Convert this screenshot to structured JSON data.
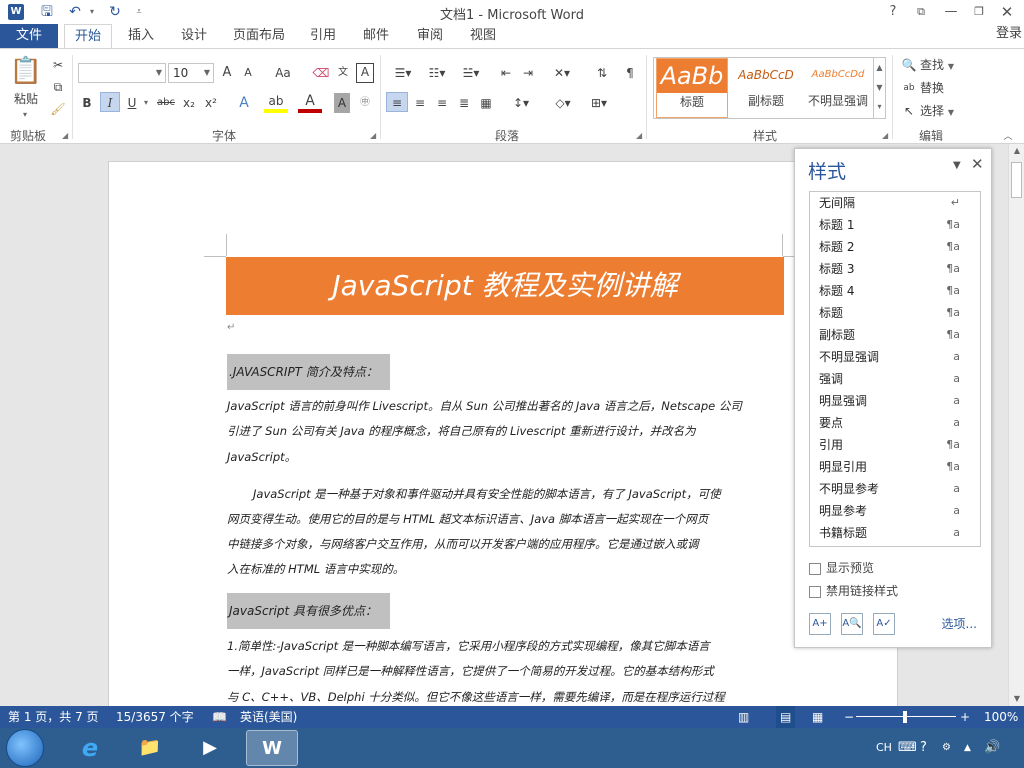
{
  "titlebar": {
    "app_icon": "W",
    "title": "文档1 - Microsoft Word",
    "qat_icons": [
      "save-icon",
      "undo-icon",
      "redo-icon",
      "customize-icon"
    ],
    "help": "?"
  },
  "tabs": {
    "file": "文件",
    "items": [
      "开始",
      "插入",
      "设计",
      "页面布局",
      "引用",
      "邮件",
      "审阅",
      "视图"
    ],
    "active": "开始",
    "login": "登录"
  },
  "ribbon": {
    "clipboard": {
      "paste": "粘贴",
      "group": "剪贴板"
    },
    "font": {
      "name_value": "",
      "size_value": "10",
      "grow": "A",
      "shrink": "A",
      "case": "Aa",
      "bold": "B",
      "italic": "I",
      "underline": "U",
      "strike": "abc",
      "subscript": "x₂",
      "superscript": "x²",
      "group": "字体"
    },
    "paragraph": {
      "group": "段落"
    },
    "styles": {
      "items": [
        {
          "preview": "AaBb",
          "label": "标题"
        },
        {
          "preview": "AaBbCcD",
          "label": "副标题"
        },
        {
          "preview": "AaBbCcDd",
          "label": "不明显强调"
        }
      ],
      "group": "样式"
    },
    "editing": {
      "find": "查找",
      "replace": "替换",
      "select": "选择",
      "group": "编辑"
    }
  },
  "document": {
    "title": "JavaScript 教程及实例讲解",
    "heading1": ".JAVASCRIPT 简介及特点：",
    "para1": [
      "JavaScript 语言的前身叫作 Livescript。自从 Sun 公司推出著名的 Java 语言之后，Netscape 公司",
      "引进了 Sun 公司有关 Java 的程序概念，将自己原有的 Livescript  重新进行设计，并改名为",
      "JavaScript。"
    ],
    "para2": [
      "JavaScript 是一种基于对象和事件驱动并具有安全性能的脚本语言，有了 JavaScript，可使",
      "网页变得生动。使用它的目的是与 HTML 超文本标识语言、Java  脚本语言一起实现在一个网页",
      "中链接多个对象，与网络客户交互作用，从而可以开发客户端的应用程序。它是通过嵌入或调",
      "入在标准的 HTML 语言中实现的。"
    ],
    "heading2": "JavaScript 具有很多优点：",
    "para3": [
      "1.简单性:-JavaScript 是一种脚本编写语言，它采用小程序段的方式实现编程，像其它脚本语言",
      "一样，JavaScript 同样已是一种解释性语言，它提供了一个简易的开发过程。它的基本结构形式",
      "与 C、C++、VB、Delphi 十分类似。但它不像这些语言一样，需要先编译，而是在程序运行过程"
    ]
  },
  "styles_pane": {
    "title": "样式",
    "rows": [
      {
        "name": "无间隔",
        "sym": "↵"
      },
      {
        "name": "标题 1",
        "sym": "¶a"
      },
      {
        "name": "标题 2",
        "sym": "¶a"
      },
      {
        "name": "标题 3",
        "sym": "¶a"
      },
      {
        "name": "标题 4",
        "sym": "¶a"
      },
      {
        "name": "标题",
        "sym": "¶a"
      },
      {
        "name": "副标题",
        "sym": "¶a"
      },
      {
        "name": "不明显强调",
        "sym": "a"
      },
      {
        "name": "强调",
        "sym": "a"
      },
      {
        "name": "明显强调",
        "sym": "a"
      },
      {
        "name": "要点",
        "sym": "a"
      },
      {
        "name": "引用",
        "sym": "¶a"
      },
      {
        "name": "明显引用",
        "sym": "¶a"
      },
      {
        "name": "不明显参考",
        "sym": "a"
      },
      {
        "name": "明显参考",
        "sym": "a"
      },
      {
        "name": "书籍标题",
        "sym": "a"
      }
    ],
    "show_preview": "显示预览",
    "disable_linked": "禁用链接样式",
    "options": "选项..."
  },
  "statusbar": {
    "page": "第 1 页，共 7 页",
    "words": "15/3657 个字",
    "language": "英语(美国)",
    "zoom": "100%",
    "zoom_minus": "−",
    "zoom_plus": "+"
  },
  "taskbar": {
    "tray_lang": "CH"
  },
  "colors": {
    "accent": "#2b579a",
    "title_bg": "#ed7d31",
    "heading_bg": "#c0c0c0"
  }
}
